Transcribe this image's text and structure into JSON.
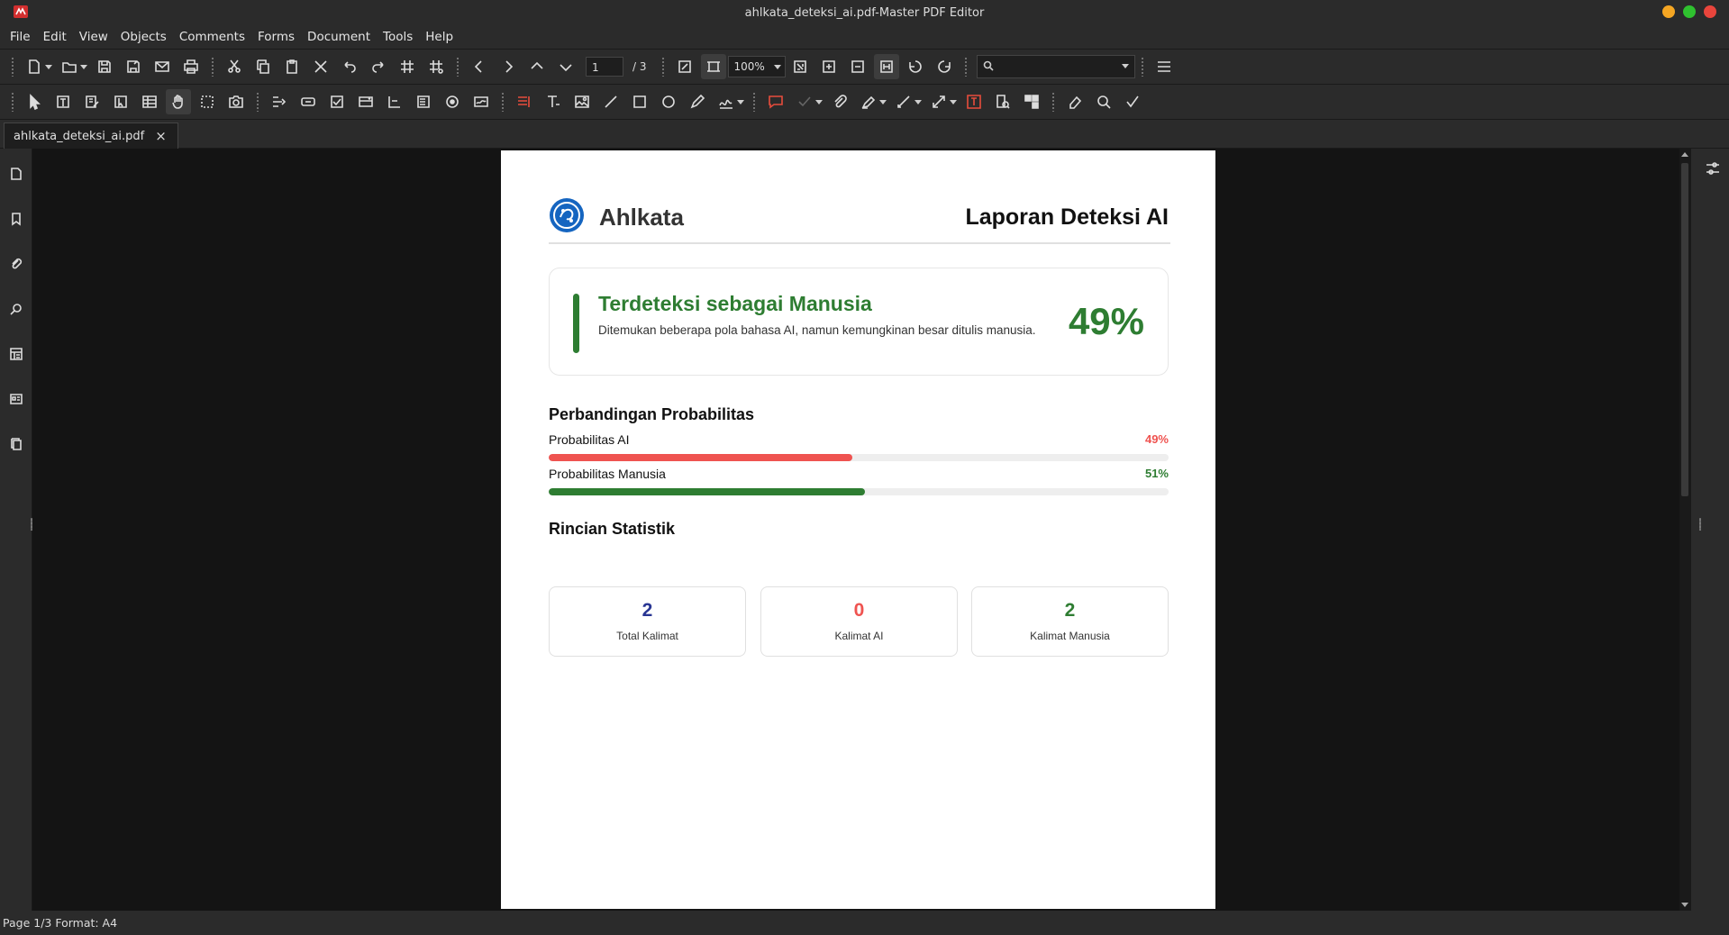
{
  "window": {
    "title": "ahlkata_deteksi_ai.pdf-Master PDF Editor",
    "traffic_colors": [
      "#f5a623",
      "#2fc12f",
      "#e9453c"
    ]
  },
  "menu": [
    "File",
    "Edit",
    "View",
    "Objects",
    "Comments",
    "Forms",
    "Document",
    "Tools",
    "Help"
  ],
  "toolbar": {
    "page_current": "1",
    "page_total": "/ 3",
    "zoom": "100%",
    "search_placeholder": ""
  },
  "tab": {
    "label": "ahlkata_deteksi_ai.pdf",
    "close": "×"
  },
  "status": {
    "text": "Page 1/3 Format: A4"
  },
  "document": {
    "brand": "Ahlkata",
    "report_title": "Laporan Deteksi AI",
    "result": {
      "title": "Terdeteksi sebagai Manusia",
      "description": "Ditemukan beberapa pola bahasa AI, namun kemungkinan besar ditulis manusia.",
      "percent": "49%",
      "color": "#2e7d32"
    },
    "probability_section_title": "Perbandingan Probabilitas",
    "probabilities": [
      {
        "label": "Probabilitas AI",
        "value_text": "49%",
        "value": 0.49,
        "color": "#ef5350"
      },
      {
        "label": "Probabilitas Manusia",
        "value_text": "51%",
        "value": 0.51,
        "color": "#2e7d32"
      }
    ],
    "stats_section_title": "Rincian Statistik",
    "stats": [
      {
        "value": "2",
        "label": "Total Kalimat",
        "color": "#283593"
      },
      {
        "value": "0",
        "label": "Kalimat AI",
        "color": "#ef5350"
      },
      {
        "value": "2",
        "label": "Kalimat Manusia",
        "color": "#2e7d32"
      }
    ]
  }
}
